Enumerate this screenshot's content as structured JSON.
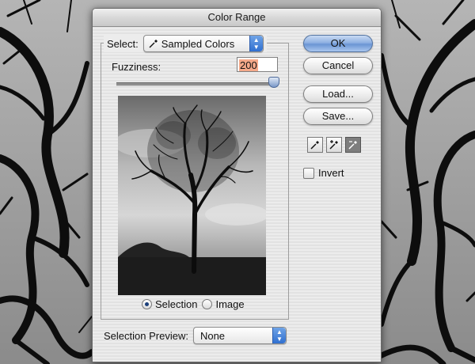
{
  "dialog": {
    "title": "Color Range"
  },
  "select": {
    "label": "Select:",
    "value": "Sampled Colors"
  },
  "fuzziness": {
    "label": "Fuzziness:",
    "value": "200",
    "slider_fraction": 1.0
  },
  "radios": [
    {
      "label": "Selection",
      "checked": true
    },
    {
      "label": "Image",
      "checked": false
    }
  ],
  "buttons": {
    "ok": "OK",
    "cancel": "Cancel",
    "load": "Load...",
    "save": "Save..."
  },
  "tools": [
    {
      "icon": "eyedropper-icon",
      "active": false
    },
    {
      "icon": "eyedropper-plus-icon",
      "active": false
    },
    {
      "icon": "eyedropper-minus-icon",
      "active": true
    }
  ],
  "invert": {
    "label": "Invert",
    "checked": false
  },
  "selection_preview": {
    "label": "Selection Preview:",
    "value": "None"
  }
}
